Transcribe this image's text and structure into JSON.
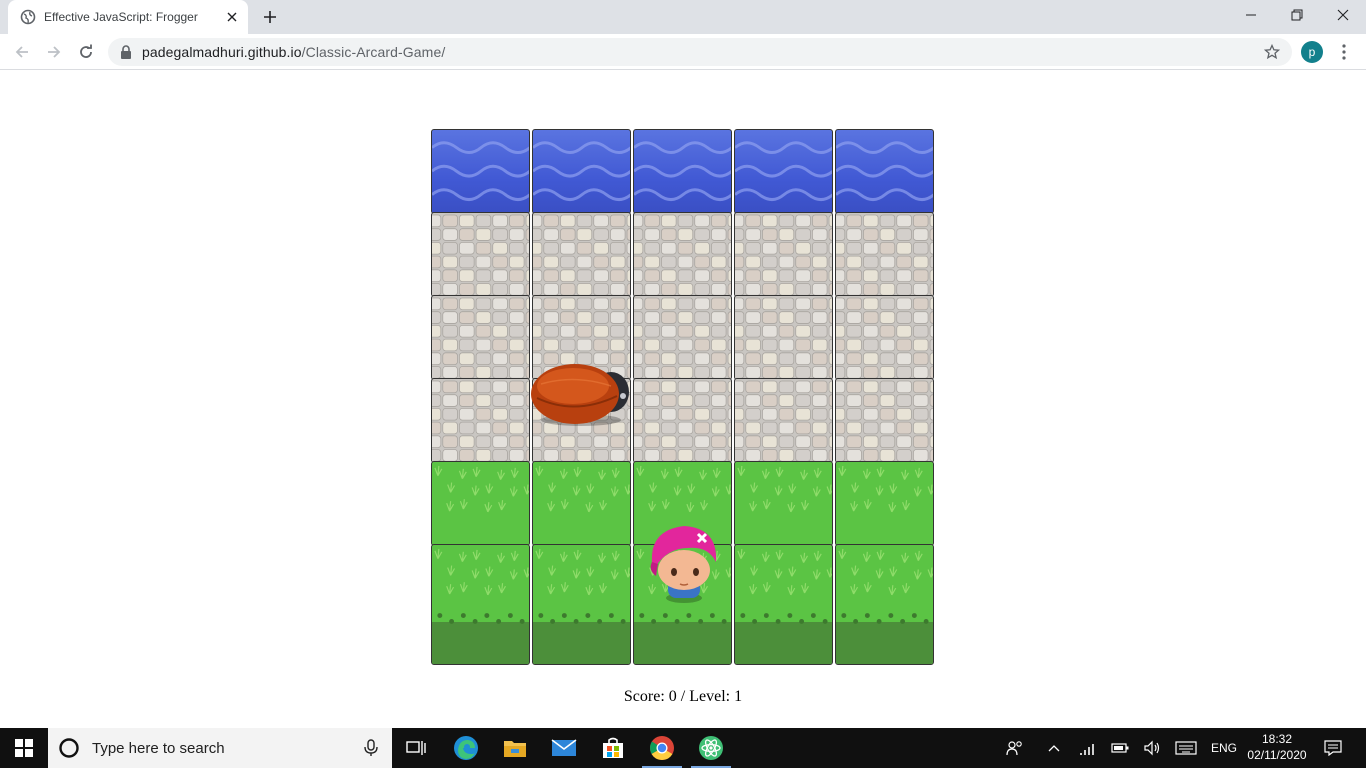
{
  "browser": {
    "tab_title": "Effective JavaScript: Frogger",
    "url_domain": "padegalmadhuri.github.io",
    "url_path": "/Classic-Arcard-Game/",
    "profile_initial": "p"
  },
  "game": {
    "rows": [
      "water",
      "stone",
      "stone",
      "stone",
      "grass",
      "grass"
    ],
    "columns": 5,
    "enemy": {
      "row": 3,
      "col": 1
    },
    "player": {
      "row": 5,
      "col": 2
    },
    "score_text": "Score: 0 / Level: 1"
  },
  "taskbar": {
    "search_placeholder": "Type here to search",
    "language": "ENG",
    "time": "18:32",
    "date": "02/11/2020"
  }
}
